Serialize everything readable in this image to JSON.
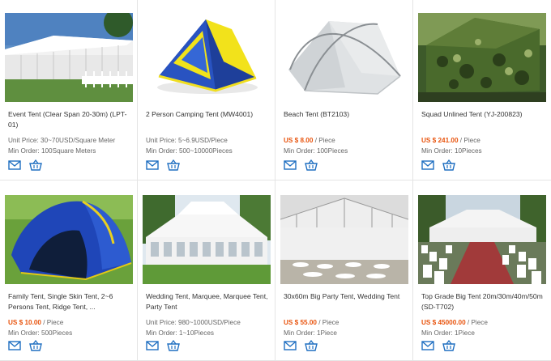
{
  "products": [
    {
      "title": "Event Tent (Clear Span 20-30m) (LPT-01)",
      "price_prefix": "Unit Price: ",
      "price": "30~70USD/Square Meter",
      "price_unit": "",
      "min_order_label": "Min Order: ",
      "min_order": "100Square Meters",
      "price_style": "plain"
    },
    {
      "title": "2 Person Camping Tent (MW4001)",
      "price_prefix": "Unit Price: ",
      "price": "5~6.9USD/Piece",
      "price_unit": "",
      "min_order_label": "Min Order: ",
      "min_order": "500~10000Pieces",
      "price_style": "plain"
    },
    {
      "title": "Beach Tent (BT2103)",
      "price_prefix": "",
      "price": "US $ 8.00",
      "price_unit": " / Piece",
      "min_order_label": "Min Order: ",
      "min_order": "100Pieces",
      "price_style": "highlight"
    },
    {
      "title": "Squad Unlined Tent (YJ-200823)",
      "price_prefix": "",
      "price": "US $ 241.00",
      "price_unit": " / Piece",
      "min_order_label": "Min Order: ",
      "min_order": "10Pieces",
      "price_style": "highlight"
    },
    {
      "title": "Family Tent, Single Skin Tent, 2~6 Persons Tent, Ridge Tent, ...",
      "price_prefix": "",
      "price": "US $ 10.00",
      "price_unit": " / Piece",
      "min_order_label": "Min Order: ",
      "min_order": "500Pieces",
      "price_style": "highlight"
    },
    {
      "title": "Wedding Tent, Marquee, Marquee Tent, Party Tent",
      "price_prefix": "Unit Price: ",
      "price": "980~1000USD/Piece",
      "price_unit": "",
      "min_order_label": "Min Order: ",
      "min_order": "1~10Pieces",
      "price_style": "plain"
    },
    {
      "title": "30x60m Big Party Tent, Wedding Tent",
      "price_prefix": "",
      "price": "US $ 55.00",
      "price_unit": " / Piece",
      "min_order_label": "Min Order: ",
      "min_order": "1Piece",
      "price_style": "highlight"
    },
    {
      "title": "Top Grade Big Tent 20m/30m/40m/50m (SD-T702)",
      "price_prefix": "",
      "price": "US $ 45000.00",
      "price_unit": " / Piece",
      "min_order_label": "Min Order: ",
      "min_order": "1Piece",
      "price_style": "highlight"
    }
  ],
  "icons": {
    "inquiry": "envelope-icon",
    "cart": "basket-icon"
  },
  "colors": {
    "price_highlight": "#e8540e",
    "icon_blue": "#1f6fc1",
    "border": "#e4e4e4"
  }
}
